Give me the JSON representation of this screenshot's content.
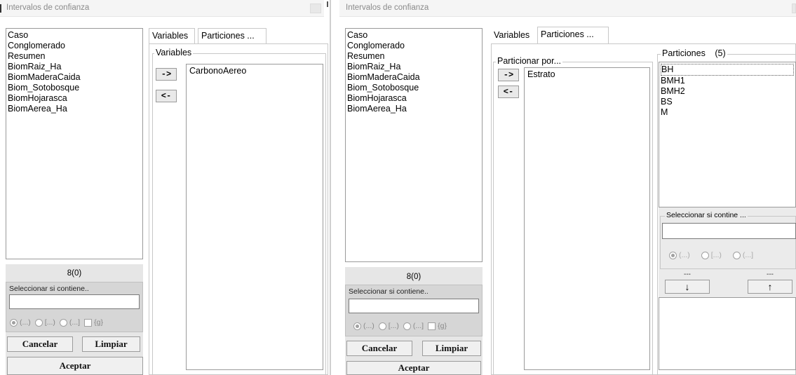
{
  "left": {
    "title": "Intervalos de confianza",
    "variables_list": [
      "Caso",
      "Conglomerado",
      "Resumen",
      "BiomRaiz_Ha",
      "BiomMaderaCaida",
      "Biom_Sotobosque",
      "BiomHojarasca",
      "BiomAerea_Ha"
    ],
    "count": "8(0)",
    "select_label": "Seleccionar si contiene..",
    "select_value": "",
    "radio_options": [
      "(...)",
      "[...)",
      "(...]"
    ],
    "check_label": "{g}",
    "cancel_label": "Cancelar",
    "clear_label": "Limpiar",
    "accept_label": "Aceptar",
    "tabs": [
      "Variables",
      "Particiones ..."
    ],
    "group_label": "Variables",
    "add_arrow": "->",
    "remove_arrow": "<-",
    "selected_vars": [
      "CarbonoAereo"
    ]
  },
  "right": {
    "title": "Intervalos de confianza",
    "variables_list": [
      "Caso",
      "Conglomerado",
      "Resumen",
      "BiomRaiz_Ha",
      "BiomMaderaCaida",
      "Biom_Sotobosque",
      "BiomHojarasca",
      "BiomAerea_Ha"
    ],
    "count": "8(0)",
    "select_label": "Seleccionar si contiene..",
    "select_value": "",
    "radio_options": [
      "(...)",
      "[...)",
      "(...]"
    ],
    "check_label": "{g}",
    "cancel_label": "Cancelar",
    "clear_label": "Limpiar",
    "accept_label": "Aceptar",
    "tabs": [
      "Variables",
      "Particiones ..."
    ],
    "partition_group_label": "Particionar por...",
    "add_arrow": "->",
    "remove_arrow": "<-",
    "partition_vars": [
      "Estrato"
    ],
    "partitions_label": "Particiones",
    "partitions_count": "(5)",
    "partitions": [
      "BH",
      "BMH1",
      "BMH2",
      "BS",
      "M"
    ],
    "partition_select_label": "Seleccionar si contine ...",
    "partition_select_value": "",
    "partition_radio_options": [
      "(...)",
      "[...)",
      "(...]"
    ],
    "dash_left": "---",
    "dash_right": "---",
    "down_arrow": "↓",
    "up_arrow": "↑"
  }
}
